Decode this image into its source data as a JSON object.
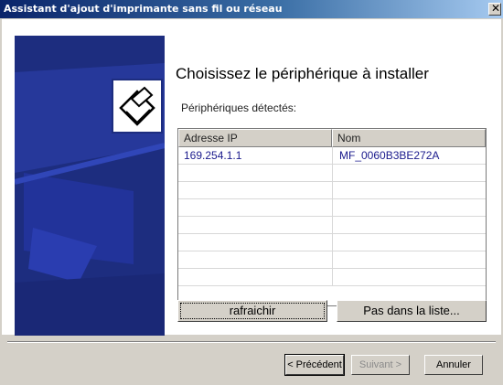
{
  "window": {
    "title": "Assistant d'ajout d'imprimante sans fil ou réseau",
    "close_glyph": "✕"
  },
  "page": {
    "heading": "Choisissez le périphérique à installer",
    "detected_label": "Périphériques détectés:"
  },
  "devices": {
    "columns": [
      "Adresse IP",
      "Nom"
    ],
    "rows": [
      {
        "ip": "169.254.1.1",
        "name": "MF_0060B3BE272A"
      }
    ],
    "empty_rows": 7
  },
  "actions": {
    "refresh": "rafraichir",
    "not_listed": "Pas dans la liste..."
  },
  "nav": {
    "previous": "< Précédent",
    "next": "Suivant >",
    "cancel": "Annuler"
  },
  "colors": {
    "accent": "#1d2d7f",
    "title_bar": "#0a246a",
    "ip_text": "#1a1a8c"
  },
  "icons": {
    "printer": "printer-icon",
    "close": "close-icon"
  }
}
